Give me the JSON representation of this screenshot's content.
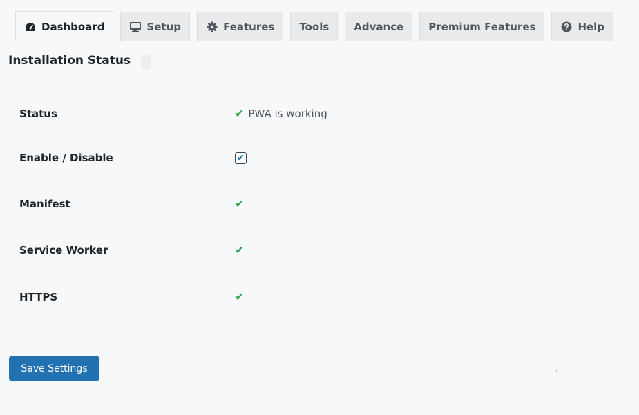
{
  "tabs": [
    {
      "label": "Dashboard",
      "icon": "dashboard-icon",
      "active": true
    },
    {
      "label": "Setup",
      "icon": "monitor-icon",
      "active": false
    },
    {
      "label": "Features",
      "icon": "gear-icon",
      "active": false
    },
    {
      "label": "Tools",
      "icon": "",
      "active": false
    },
    {
      "label": "Advance",
      "icon": "",
      "active": false
    },
    {
      "label": "Premium Features",
      "icon": "",
      "active": false
    },
    {
      "label": "Help",
      "icon": "help-icon",
      "active": false
    }
  ],
  "section": {
    "title": "Installation Status"
  },
  "rows": {
    "status": {
      "label": "Status",
      "value": "PWA is working"
    },
    "enable": {
      "label": "Enable / Disable",
      "checked": true
    },
    "manifest": {
      "label": "Manifest"
    },
    "service_worker": {
      "label": "Service Worker"
    },
    "https": {
      "label": "HTTPS"
    }
  },
  "check_glyph": "✔",
  "actions": {
    "save_label": "Save Settings"
  },
  "colors": {
    "accent": "#2271b1",
    "success": "#32a852"
  }
}
